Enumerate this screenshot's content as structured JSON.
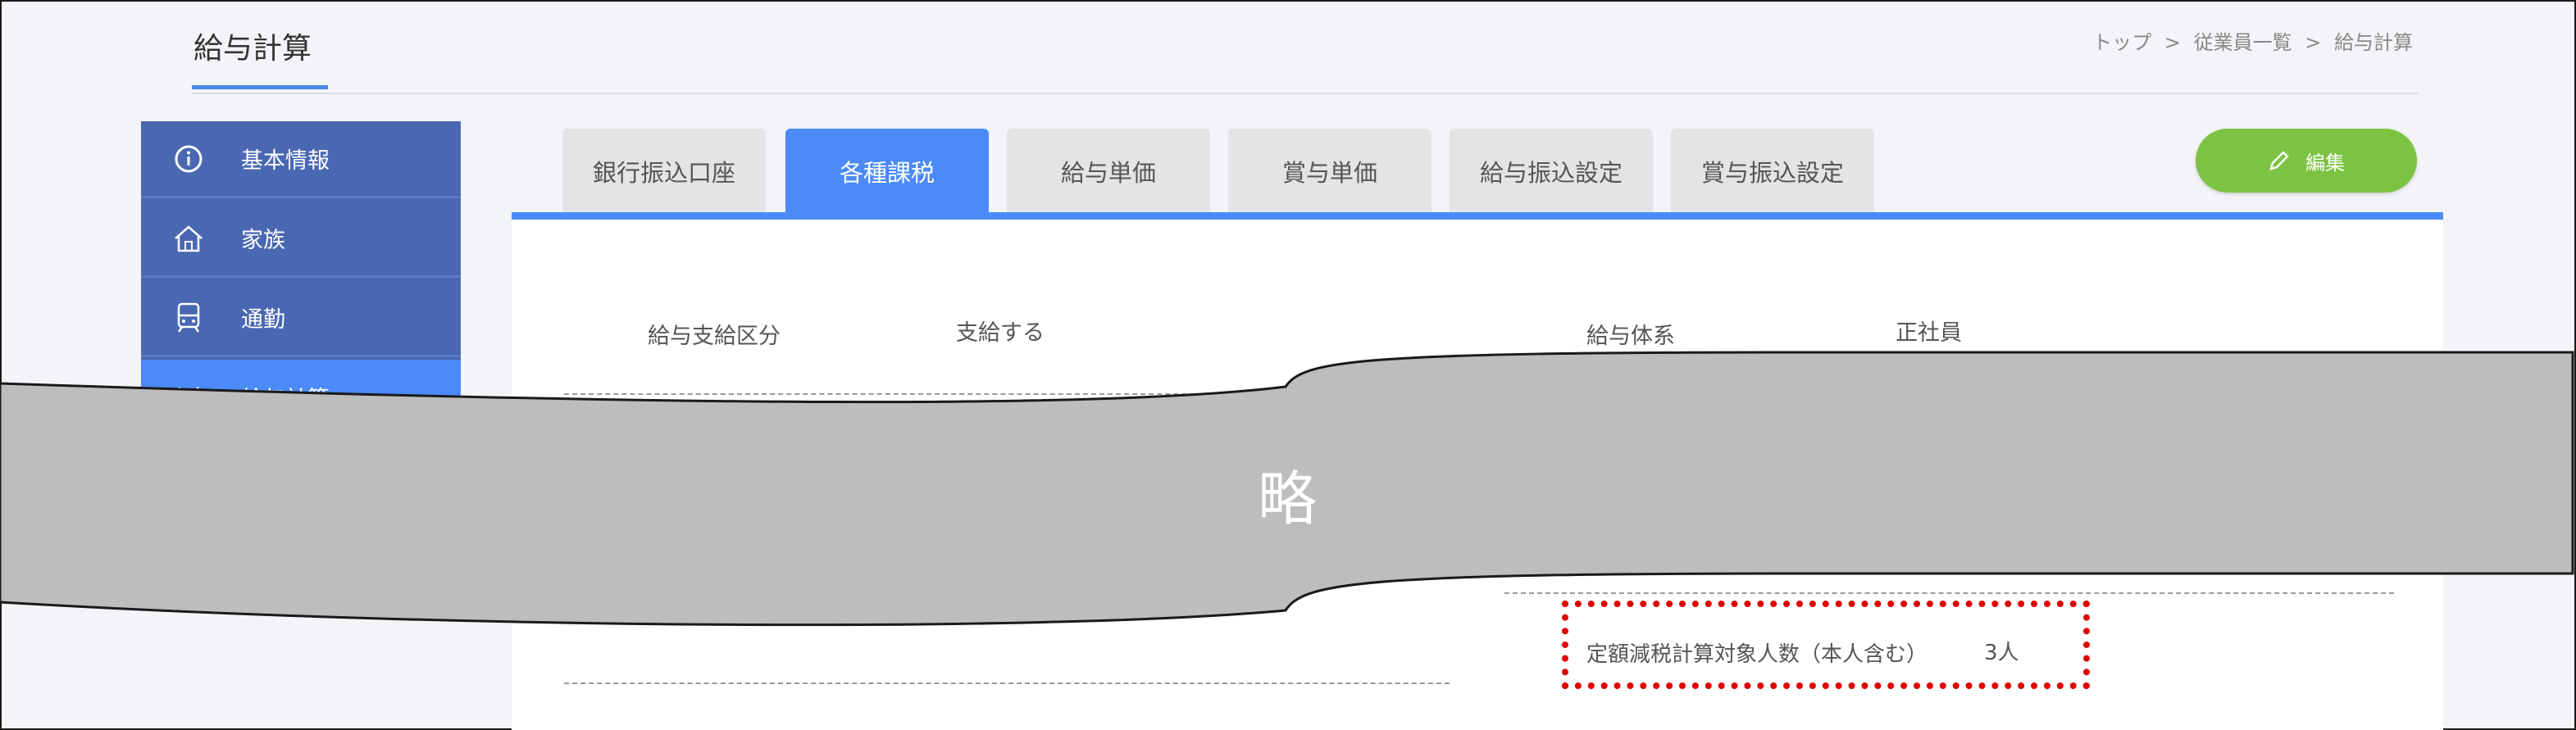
{
  "header": {
    "title": "給与計算"
  },
  "breadcrumb": {
    "items": [
      "トップ",
      "従業員一覧",
      "給与計算"
    ],
    "separator": ">"
  },
  "sidebar": {
    "items": [
      {
        "label": "基本情報",
        "icon": "info-icon"
      },
      {
        "label": "家族",
        "icon": "house-icon"
      },
      {
        "label": "通勤",
        "icon": "train-icon"
      },
      {
        "label": "給与計算",
        "icon": "tools-icon",
        "active": true
      }
    ]
  },
  "tabs": [
    {
      "label": "銀行振込口座"
    },
    {
      "label": "各種課税",
      "active": true
    },
    {
      "label": "給与単価"
    },
    {
      "label": "賞与単価"
    },
    {
      "label": "給与振込設定"
    },
    {
      "label": "賞与振込設定"
    }
  ],
  "edit_button": {
    "label": "編集",
    "icon": "pencil-icon"
  },
  "fields": {
    "pay_category_label": "給与支給区分",
    "pay_category_value": "支給する",
    "pay_system_label": "給与体系",
    "pay_system_value": "正社員"
  },
  "omission": {
    "text": "略"
  },
  "highlight": {
    "label": "定額減税計算対象人数（本人含む）",
    "value": "3人"
  },
  "colors": {
    "accent": "#4b8af8",
    "sidebar": "#4a68b2",
    "edit": "#7cc343",
    "highlight": "#e00000"
  }
}
